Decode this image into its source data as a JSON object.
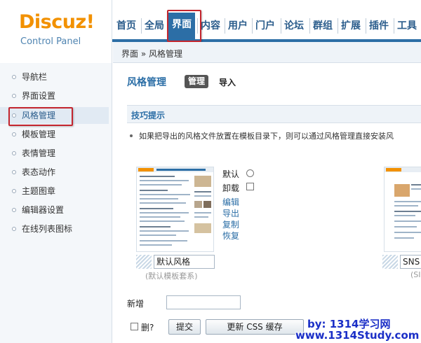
{
  "logo": {
    "name": "Discuz!",
    "subtitle": "Control Panel",
    "brand_color": "#f29100"
  },
  "nav": {
    "items": [
      "首页",
      "全局",
      "界面",
      "内容",
      "用户",
      "门户",
      "论坛",
      "群组",
      "扩展",
      "插件",
      "工具"
    ],
    "active_index": 2,
    "accent_color": "#2c6ea6"
  },
  "breadcrumb": {
    "text": "界面 » 风格管理"
  },
  "sidebar": {
    "items": [
      "导航栏",
      "界面设置",
      "风格管理",
      "模板管理",
      "表情管理",
      "表态动作",
      "主题图章",
      "编辑器设置",
      "在线列表图标"
    ],
    "active_index": 2
  },
  "main": {
    "title": "风格管理",
    "tabs": {
      "manage": "管理",
      "import": "导入"
    },
    "tips": {
      "title": "技巧提示",
      "text": "如果把导出的风格文件放置在模板目录下，则可以通过风格管理直接安装风"
    },
    "themes": [
      {
        "name_value": "默认风格",
        "caption": "(默认模板套系)",
        "options": {
          "default": "默认",
          "uninstall": "卸载"
        },
        "links": [
          "编辑",
          "导出",
          "复制",
          "恢复"
        ]
      },
      {
        "name_value": "SNS",
        "caption": "(SI"
      }
    ],
    "new_label": "新增",
    "delete_label": "删?",
    "buttons": {
      "submit": "提交",
      "refresh_css": "更新 CSS 缓存"
    }
  },
  "watermark": {
    "line1": "by: 1314学习网",
    "line2": "www.1314Study.com"
  }
}
